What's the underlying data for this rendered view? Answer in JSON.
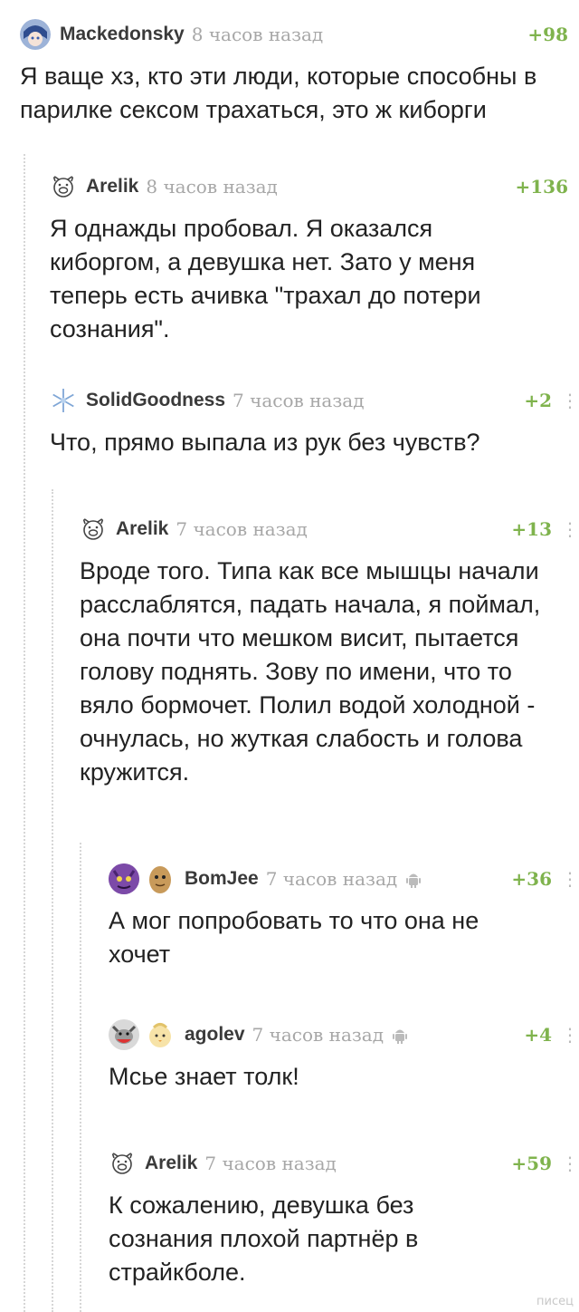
{
  "comments": [
    {
      "username": "Mackedonsky",
      "time": "8 часов назад",
      "rating": "+98",
      "text": "Я ваще хз, кто эти люди, которые способны в парилке сексом трахаться, это ж киборги"
    },
    {
      "username": "Arelik",
      "time": "8 часов назад",
      "rating": "+136",
      "text": "Я однажды пробовал. Я оказался киборгом, а девушка нет. Зато у меня теперь есть ачивка \"трахал до потери сознания\"."
    },
    {
      "username": "SolidGoodness",
      "time": "7 часов назад",
      "rating": "+2",
      "text": "Что, прямо выпала из рук без чувств?"
    },
    {
      "username": "Arelik",
      "time": "7 часов назад",
      "rating": "+13",
      "text": "Вроде того. Типа как все мышцы начали расслаблятся, падать начала, я поймал, она почти что мешком висит, пытается голову поднять. Зову по имени, что то вяло бормочет. Полил водой холодной - очнулась, но жуткая слабость и голова кружится."
    },
    {
      "username": "BomJee",
      "time": "7 часов назад",
      "rating": "+36",
      "text": "А мог попробовать то что она не хочет"
    },
    {
      "username": "agolev",
      "time": "7 часов назад",
      "rating": "+4",
      "text": "Мсье знает толк!"
    },
    {
      "username": "Arelik",
      "time": "7 часов назад",
      "rating": "+59",
      "text": "К сожалению, девушка без сознания плохой партнёр в страйкболе."
    }
  ],
  "more_glyph": "⋮",
  "watermark": "писец",
  "colors": {
    "rating": "#7fb34d",
    "time": "#a7a7a7",
    "thread_line": "#d6d6d6"
  },
  "icons": [
    "anime-avatar-icon",
    "pig-avatar-icon",
    "snowflake-avatar-icon",
    "purple-monster-avatar-icon",
    "potato-avatar-icon",
    "wolf-avatar-icon",
    "chick-avatar-icon",
    "android-icon",
    "more-options-icon"
  ]
}
